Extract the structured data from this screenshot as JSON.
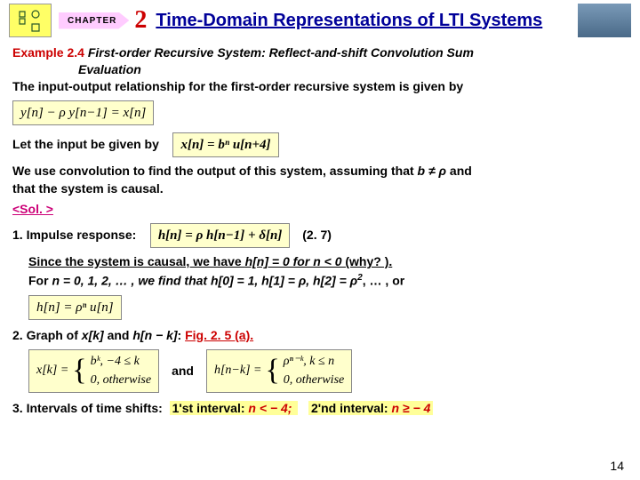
{
  "header": {
    "chapter_label": "CHAPTER",
    "chapter_num": "2",
    "title": "Time-Domain Representations of LTI Systems"
  },
  "example": {
    "tag": "Example 2.4",
    "rest": " First-order Recursive System: Reflect-and-shift Convolution Sum",
    "line2": "Evaluation"
  },
  "rel": "The input-output relationship for the first-order recursive system is given by",
  "eq1": "y[n] − ρ y[n−1] = x[n]",
  "let": "Let the input be given by",
  "eq2": "x[n] = bⁿ u[n+4]",
  "conv1": "We use convolution to find the output of this system, assuming that ",
  "conv1b": "b ≠ ρ",
  "conv1c": " and",
  "conv2": "that the system is causal.",
  "sol": "<Sol. >",
  "step1": "1. Impulse response:",
  "eq3": "h[n] = ρ h[n−1] + δ[n]",
  "eqref1": "(2. 7)",
  "since": "Since the system is causal, we have ",
  "since_u": "h[n] = 0 for n < 0",
  "since_tail": " (why? ).",
  "forvals": "For ",
  "forvals2": "n = 0, 1, 2, … , we find that h[0] = 1, h[1] = ρ, h[2] = ρ",
  "forvals3": ", … , or",
  "eq4": "h[n] = ρⁿ u[n]",
  "step2a": "2. Graph of ",
  "step2b": "x[k]",
  "step2c": " and ",
  "step2d": "h[n − k]",
  "step2e": ": ",
  "step2fig": "Fig. 2. 5 (a).",
  "xk_lhs": "x[k] =",
  "xk_case1": "bᵏ,    −4 ≤ k",
  "xk_case2": "0,    otherwise",
  "and": "and",
  "hk_lhs": "h[n−k] =",
  "hk_case1": "ρⁿ⁻ᵏ,    k ≤ n",
  "hk_case2": "0,    otherwise",
  "step3": "3. Intervals of time shifts:",
  "int1a": "1'st interval: ",
  "int1b": "n < − 4;",
  "int2a": "2'nd interval:  ",
  "int2b": "n ≥ − 4",
  "pagenum": "14"
}
